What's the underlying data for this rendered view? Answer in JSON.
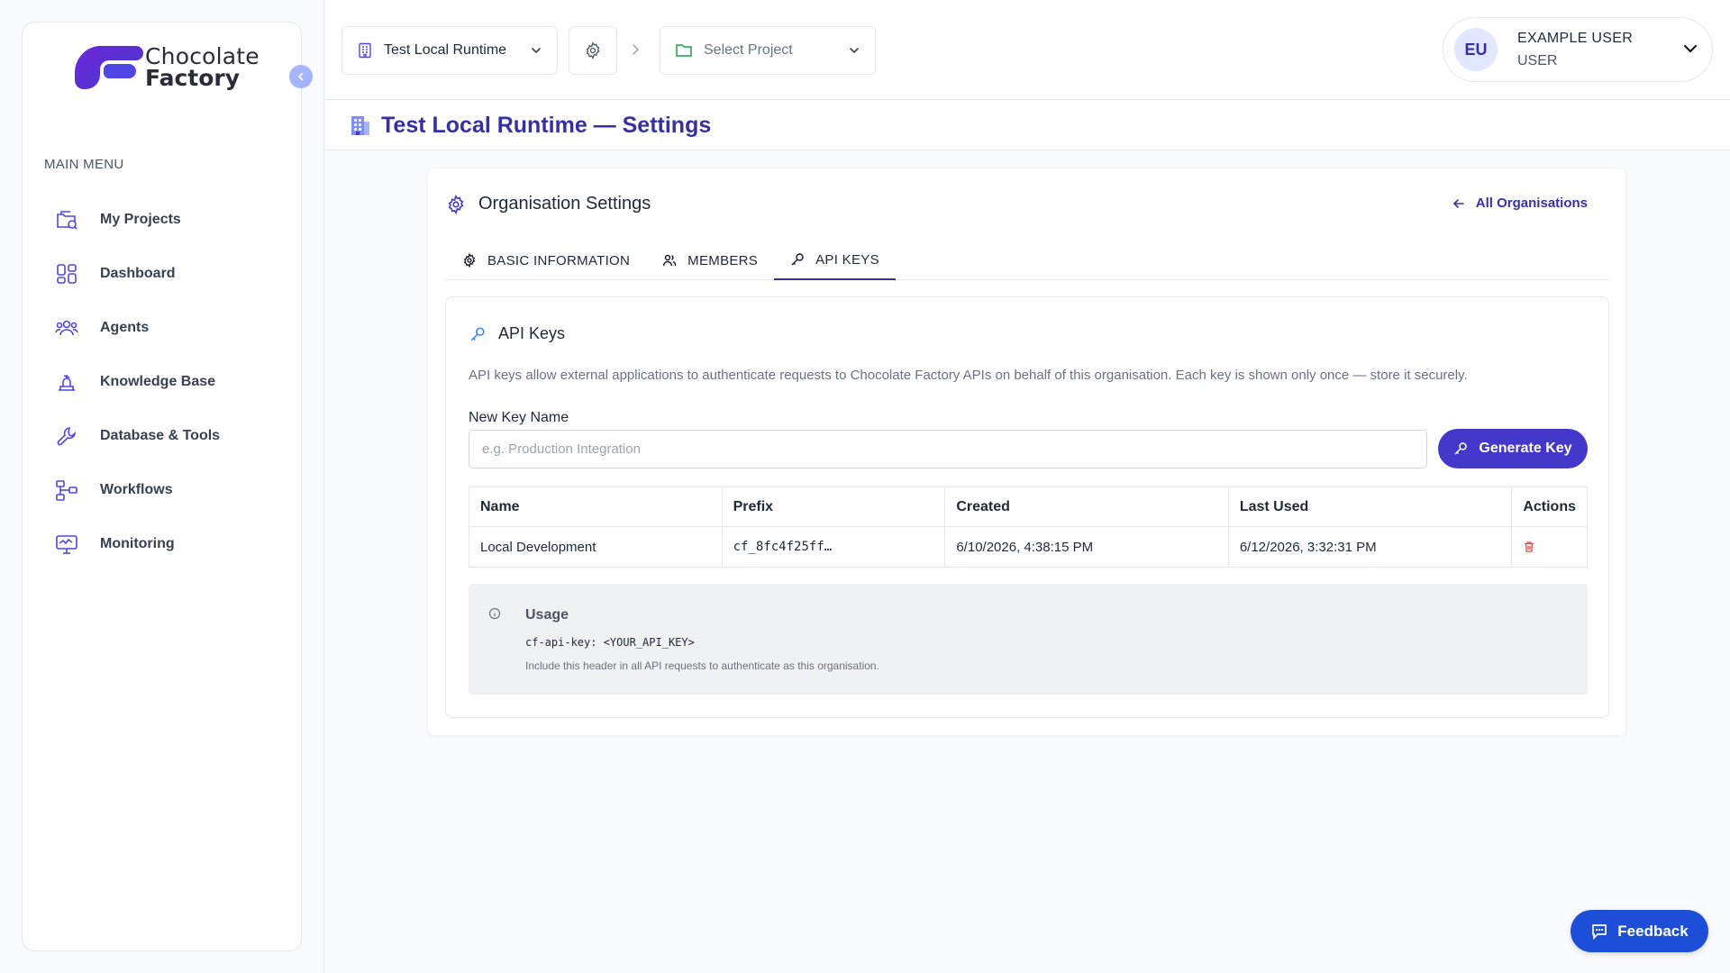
{
  "brand": {
    "line1": "Chocolate",
    "line2": "Factory"
  },
  "sidebar": {
    "menu_label": "MAIN MENU",
    "items": [
      {
        "label": "My Projects",
        "icon": "projects-icon"
      },
      {
        "label": "Dashboard",
        "icon": "dashboard-icon"
      },
      {
        "label": "Agents",
        "icon": "agents-icon"
      },
      {
        "label": "Knowledge Base",
        "icon": "knowledge-base-icon"
      },
      {
        "label": "Database & Tools",
        "icon": "wrench-icon"
      },
      {
        "label": "Workflows",
        "icon": "workflows-icon"
      },
      {
        "label": "Monitoring",
        "icon": "monitoring-icon"
      }
    ]
  },
  "topbar": {
    "runtime": "Test Local Runtime",
    "project_placeholder": "Select Project",
    "user": {
      "initials": "EU",
      "name": "EXAMPLE USER",
      "role": "USER"
    }
  },
  "page": {
    "title": "Test Local Runtime — Settings"
  },
  "card": {
    "title": "Organisation Settings",
    "back_link": "All Organisations",
    "tabs": [
      {
        "label": "BASIC INFORMATION",
        "active": false
      },
      {
        "label": "MEMBERS",
        "active": false
      },
      {
        "label": "API KEYS",
        "active": true
      }
    ]
  },
  "api_keys": {
    "title": "API Keys",
    "description": "API keys allow external applications to authenticate requests to Chocolate Factory APIs on behalf of this organisation. Each key is shown only once — store it securely.",
    "field_label": "New Key Name",
    "input_value": "",
    "input_placeholder": "e.g. Production Integration",
    "generate_label": "Generate Key",
    "columns": [
      "Name",
      "Prefix",
      "Created",
      "Last Used",
      "Actions"
    ],
    "rows": [
      {
        "name": "Local Development",
        "prefix": "cf_8fc4f25ff…",
        "created": "6/10/2026, 4:38:15 PM",
        "last_used": "6/12/2026, 3:32:31 PM"
      }
    ],
    "usage": {
      "title": "Usage",
      "code": "cf-api-key: <YOUR_API_KEY>",
      "note": "Include this header in all API requests to authenticate as this organisation."
    }
  },
  "feedback_label": "Feedback",
  "colors": {
    "accent": "#3730a3",
    "button": "#4338ca",
    "feedback": "#1d4ed8",
    "danger": "#ef4444"
  }
}
